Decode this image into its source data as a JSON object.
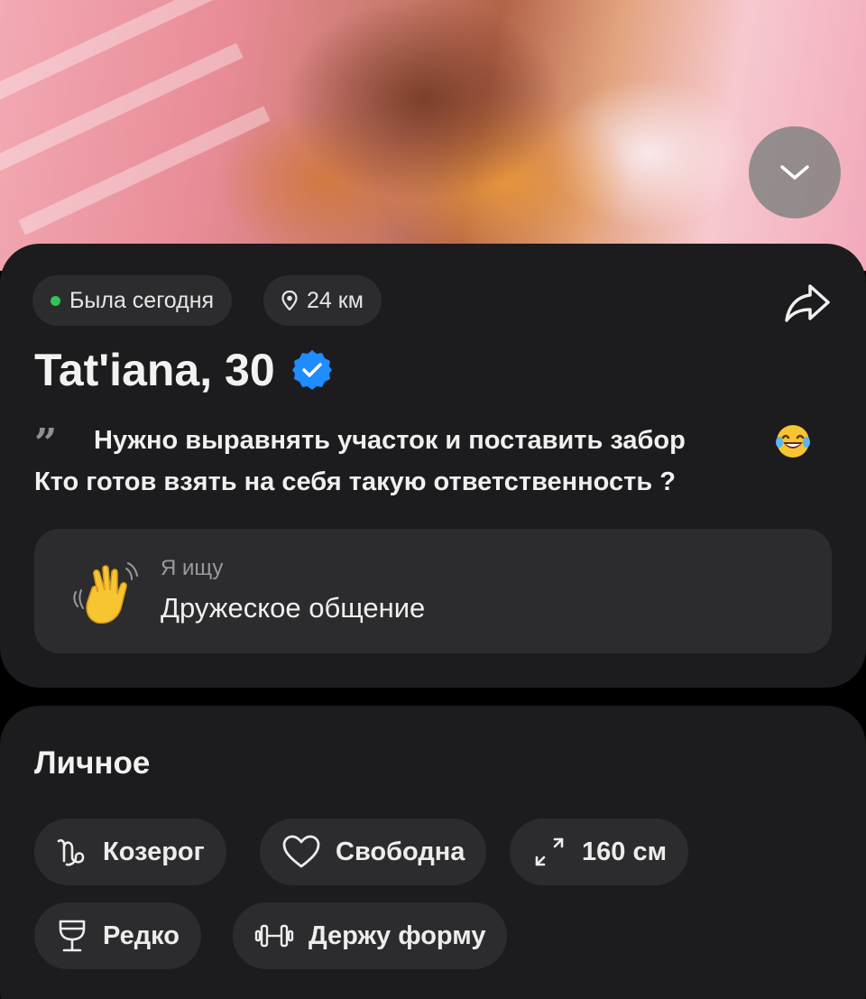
{
  "profile": {
    "status_text": "Была сегодня",
    "distance": "24 км",
    "name_age": "Tat'iana, 30",
    "bio_line1": "Нужно выравнять участок и поставить забор",
    "bio_line2": "Кто готов взять на себя такую ответственность ?",
    "seeking_label": "Я ищу",
    "seeking_value": "Дружеское общение"
  },
  "personal": {
    "title": "Личное",
    "tags": [
      {
        "icon": "capricorn-icon",
        "label": "Козерог"
      },
      {
        "icon": "heart-icon",
        "label": "Свободна"
      },
      {
        "icon": "height-arrows-icon",
        "label": "160 см"
      },
      {
        "icon": "wine-glass-icon",
        "label": "Редко"
      },
      {
        "icon": "dumbbell-icon",
        "label": "Держу форму"
      }
    ]
  },
  "icons": {
    "collapse": "chevron-down-icon",
    "share": "share-arrow-icon",
    "verified": "verified-check-icon",
    "quote": "quote-icon",
    "laugh_emoji": "laughing-tears-emoji-icon",
    "wave_emoji": "waving-hand-emoji-icon",
    "location": "location-pin-icon",
    "online": "online-status-dot"
  },
  "colors": {
    "background": "#000000",
    "card": "#1c1c1e",
    "chip": "#2c2c2e",
    "online_green": "#31c553",
    "verified_blue": "#1f8cff"
  }
}
